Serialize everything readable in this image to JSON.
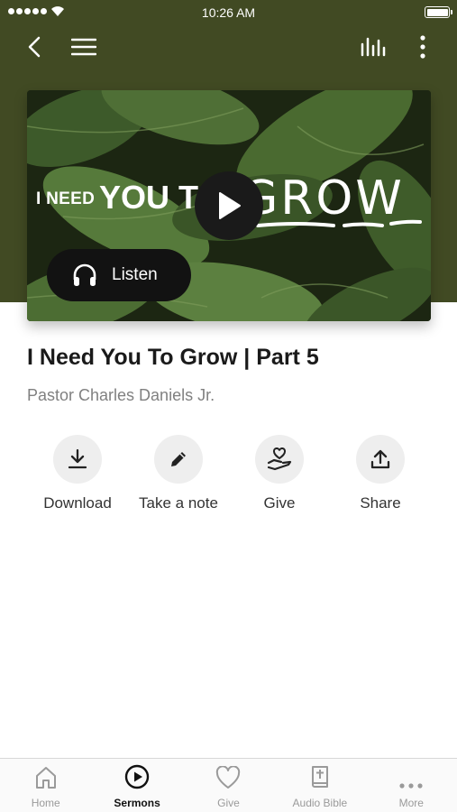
{
  "status_bar": {
    "time": "10:26 AM"
  },
  "colors": {
    "header_bg": "#414a23",
    "accent": "#111111",
    "tab_inactive": "#9a9a9a"
  },
  "nav": {
    "back_icon": "chevron-left-icon",
    "menu_icon": "hamburger-icon",
    "audio_icon": "audio-bars-icon",
    "more_icon": "vertical-dots-icon"
  },
  "hero": {
    "title_small": "I NEED",
    "title_mid": "YOU TO",
    "title_big": "GROW",
    "listen_label": "Listen"
  },
  "sermon": {
    "title": "I Need You To Grow | Part 5",
    "speaker": "Pastor Charles Daniels Jr."
  },
  "actions": [
    {
      "label": "Download",
      "icon": "download-icon"
    },
    {
      "label": "Take a note",
      "icon": "pencil-icon"
    },
    {
      "label": "Give",
      "icon": "heart-hand-icon"
    },
    {
      "label": "Share",
      "icon": "share-icon"
    }
  ],
  "tabs": [
    {
      "label": "Home",
      "icon": "home-icon",
      "active": false
    },
    {
      "label": "Sermons",
      "icon": "play-circle-icon",
      "active": true
    },
    {
      "label": "Give",
      "icon": "heart-icon",
      "active": false
    },
    {
      "label": "Audio Bible",
      "icon": "bible-icon",
      "active": false
    },
    {
      "label": "More",
      "icon": "more-dots-icon",
      "active": false
    }
  ]
}
